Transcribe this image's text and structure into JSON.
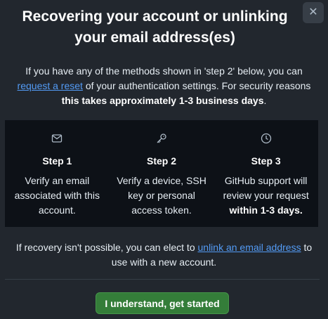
{
  "dialog": {
    "title": "Recovering your account or unlinking your email address(es)",
    "close_icon": "close-icon",
    "intro": {
      "text_before_link": "If you have any of the methods shown in 'step 2' below, you can ",
      "link_label": "request a reset",
      "text_after_link": " of your authentication settings. For security reasons ",
      "bold_text": "this takes approximately 1-3 business days",
      "text_end": "."
    },
    "steps": [
      {
        "icon": "mail-icon",
        "title": "Step 1",
        "description": "Verify an email associated with this account.",
        "description_bold": ""
      },
      {
        "icon": "key-icon",
        "title": "Step 2",
        "description": "Verify a device, SSH key or personal access token.",
        "description_bold": ""
      },
      {
        "icon": "clock-icon",
        "title": "Step 3",
        "description": "GitHub support will review your request ",
        "description_bold": "within 1-3 days."
      }
    ],
    "recovery_note": {
      "text_before_link": "If recovery isn't possible, you can elect to ",
      "link_label": "unlink an email address",
      "text_after_link": " to use with a new account."
    },
    "primary_button_label": "I understand, get started"
  },
  "colors": {
    "background": "#22272e",
    "panel": "#0d1117",
    "link": "#539bf5",
    "primary_button": "#347d39",
    "text": "#e6edf3"
  }
}
